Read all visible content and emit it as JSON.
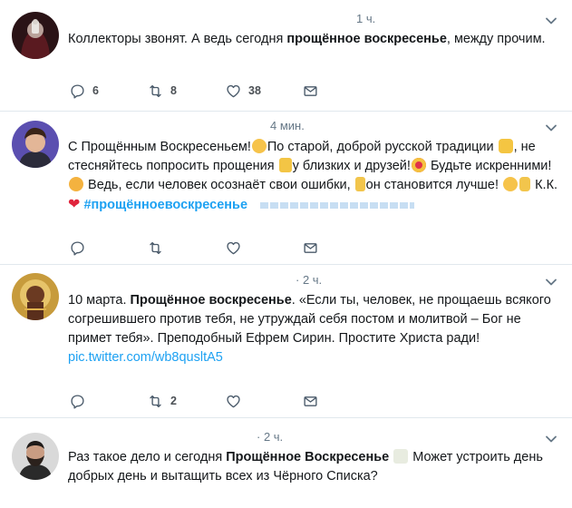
{
  "tweets": [
    {
      "time": "1 ч.",
      "text_a": "Коллекторы звонят. А ведь сегодня ",
      "text_bold": "прощённое воскресенье",
      "text_b": ", между прочим.",
      "replies": "6",
      "retweets": "8",
      "likes": "38"
    },
    {
      "time": "4 мин.",
      "text_a": "С Прощённым Воскресеньем!",
      "text_b": "По старой, доброй русской традиции",
      "text_c": ", не стесняйтесь попросить прощения",
      "text_d": "у близких и друзей!",
      "text_e": " Будьте искренними!",
      "text_f": " Ведь, если человек осознаёт свои ошибки,",
      "text_g": "он становится лучше!",
      "text_h": " К.К.",
      "hashtag": "#прощённоевоскресенье"
    },
    {
      "time": "· 2 ч.",
      "text_a": "10 марта. ",
      "text_bold": "Прощённое воскресенье",
      "text_b": ". «Если ты, человек, не прощаешь всякого согрешившего против тебя, не утруждай себя постом и молитвой – Бог не примет тебя». Преподобный Ефрем Сирин. Простите Христа ради!",
      "link": "pic.twitter.com/wb8qusltA5",
      "retweets": "2"
    },
    {
      "time": "· 2 ч.",
      "text_a": "Раз такое дело и сегодня ",
      "text_bold": "Прощённое Воскресенье",
      "text_b": " Может устроить день добрых день и вытащить всех из Чёрного Списка?"
    }
  ],
  "icons": {
    "reply": "reply-icon",
    "retweet": "retweet-icon",
    "like": "heart-icon",
    "dm": "envelope-icon",
    "more": "chevron-down-icon"
  },
  "colors": {
    "link": "#1da1f2",
    "muted": "#657786",
    "divider": "#e1e8ed",
    "icon": "#4a5a6a"
  }
}
